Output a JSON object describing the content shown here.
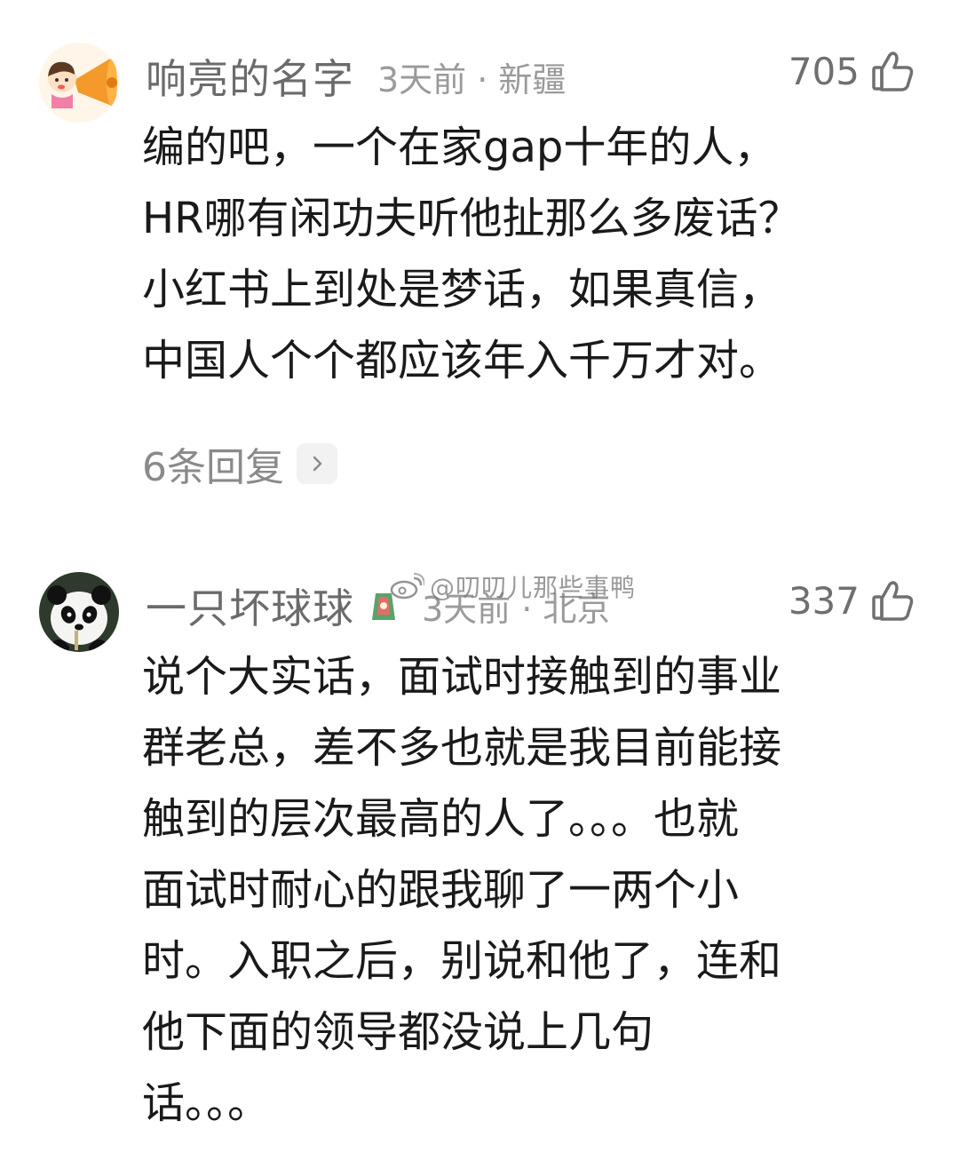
{
  "comments": [
    {
      "username": "响亮的名字",
      "meta": "3天前 · 新疆",
      "likes": "705",
      "body": [
        "编的吧，一个在家gap十年的人，",
        "HR哪有闲功夫听他扯那么多废话？",
        "小红书上到处是梦话，如果真信，",
        "中国人个个都应该年入千万才对。"
      ],
      "replies": "6条回复"
    },
    {
      "username": "一只坏球球",
      "meta": "3天前 · 北京",
      "likes": "337",
      "body": [
        "说个大实话，面试时接触到的事业",
        "群老总，差不多也就是我目前能接",
        "触到的层次最高的人了。。。也就",
        "面试时耐心的跟我聊了一两个小",
        "时。入职之后，别说和他了，连和",
        "他下面的领导都没说上几句",
        "话。。。"
      ]
    }
  ],
  "watermark": "@叨叨儿那些事鸭",
  "colors": {
    "username": "#6b6b6b",
    "meta": "#9a9a9a",
    "body": "#1a1a1a",
    "reply_bg": "#f2f2f2"
  },
  "icons": {
    "like": "thumbs-up-icon",
    "reply_arrow": "chevron-right-icon",
    "badge": "decorative-badge-icon",
    "watermark_logo": "weibo-logo-icon"
  }
}
